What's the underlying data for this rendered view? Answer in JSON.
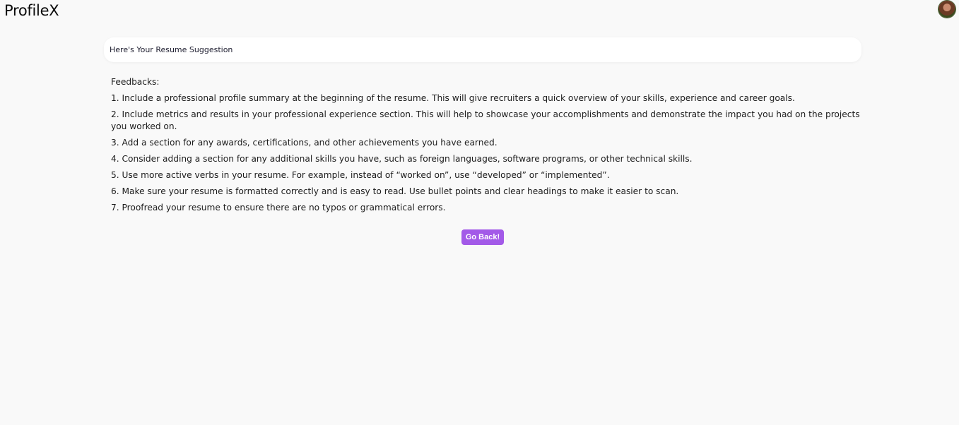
{
  "app": {
    "logo": "ProfileX",
    "avatar_icon": "user-avatar"
  },
  "card": {
    "title": "Here's Your Resume Suggestion"
  },
  "feedback": {
    "heading": "Feedbacks:",
    "items": [
      "1. Include a professional profile summary at the beginning of the resume. This will give recruiters a quick overview of your skills, experience and career goals.",
      "2. Include metrics and results in your professional experience section. This will help to showcase your accomplishments and demonstrate the impact you had on the projects you worked on.",
      "3. Add a section for any awards, certifications, and other achievements you have earned.",
      "4. Consider adding a section for any additional skills you have, such as foreign languages, software programs, or other technical skills.",
      "5. Use more active verbs in your resume. For example, instead of “worked on”, use “developed” or “implemented”.",
      "6. Make sure your resume is formatted correctly and is easy to read. Use bullet points and clear headings to make it easier to scan.",
      "7. Proofread your resume to ensure there are no typos or grammatical errors."
    ]
  },
  "actions": {
    "go_back_label": "Go Back!"
  },
  "colors": {
    "accent": "#a35ae8",
    "background": "#f9f9f9",
    "card": "#ffffff"
  }
}
